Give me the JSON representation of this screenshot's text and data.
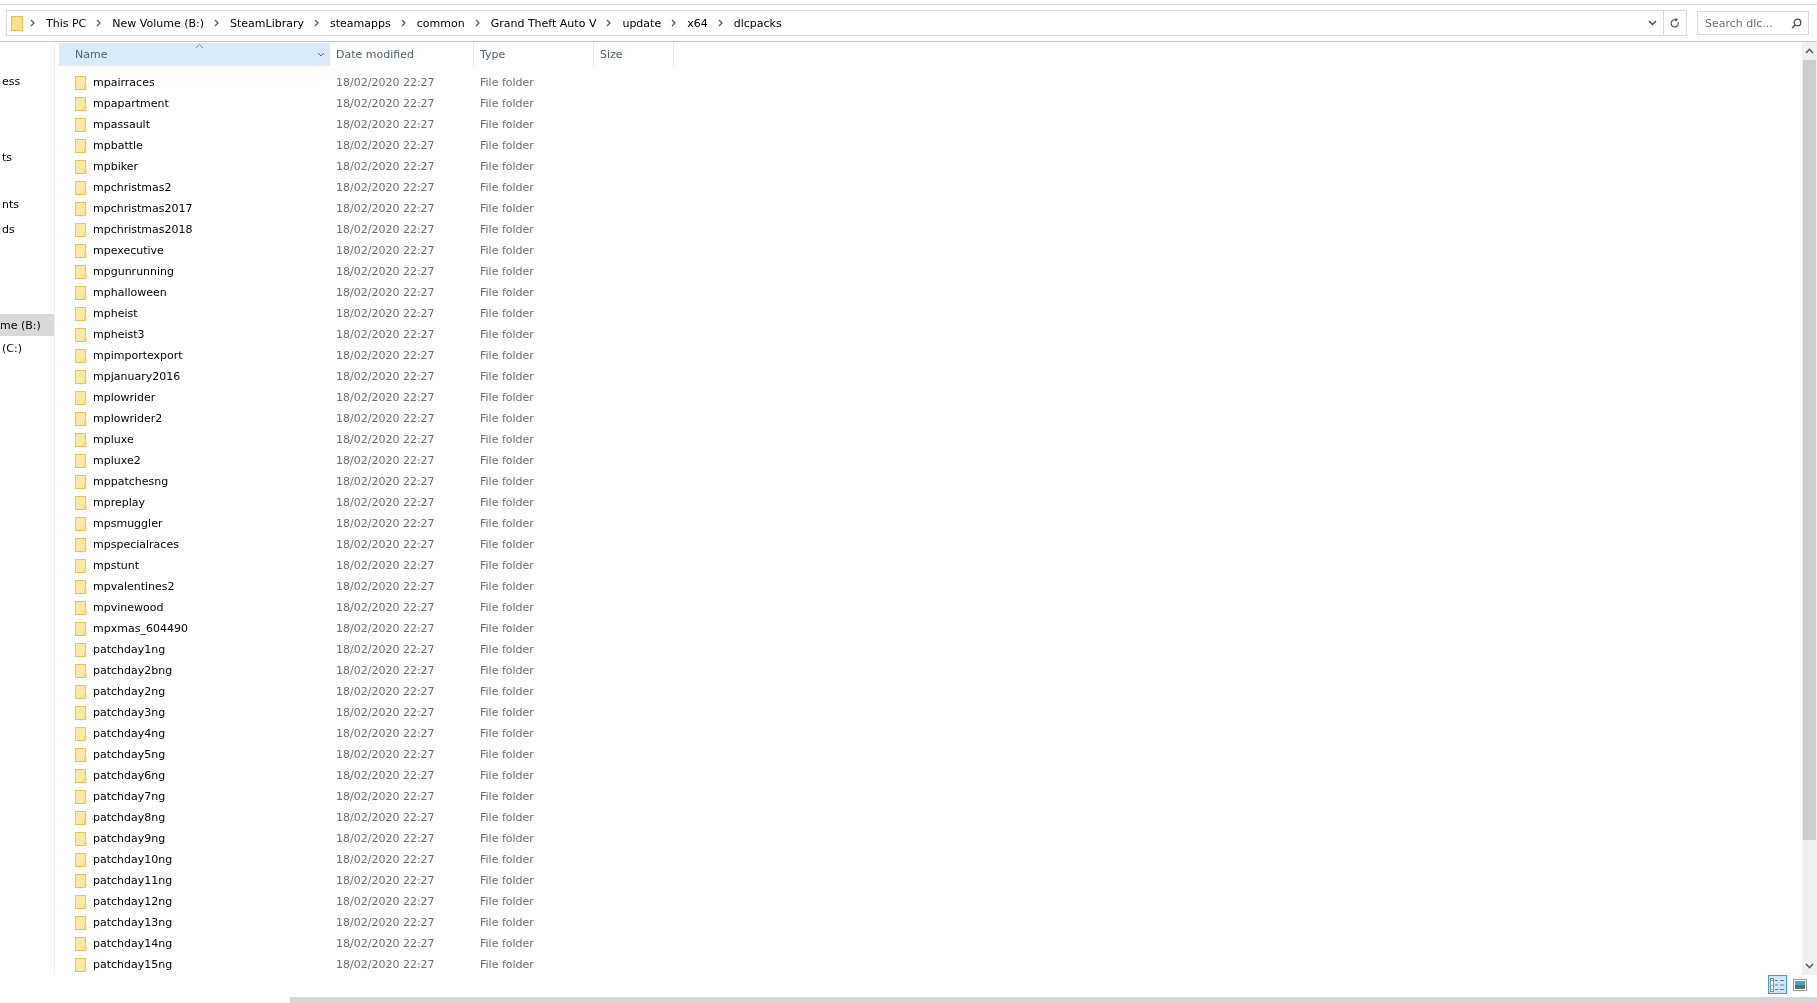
{
  "address_bar": {
    "path": [
      {
        "label": "This PC"
      },
      {
        "label": "New Volume (B:)"
      },
      {
        "label": "SteamLibrary"
      },
      {
        "label": "steamapps"
      },
      {
        "label": "common"
      },
      {
        "label": "Grand Theft Auto V"
      },
      {
        "label": "update"
      },
      {
        "label": "x64"
      },
      {
        "label": "dlcpacks"
      }
    ]
  },
  "search": {
    "placeholder": "Search dlc..."
  },
  "navigation": {
    "items": [
      {
        "label": "ess",
        "selected": false
      },
      {
        "label": "ts",
        "selected": false
      },
      {
        "label": "nts",
        "selected": false
      },
      {
        "label": "ds",
        "selected": false
      },
      {
        "label": "me (B:)",
        "selected": true
      },
      {
        "label": "(C:)",
        "selected": false
      }
    ]
  },
  "table": {
    "columns": [
      {
        "label": "Name",
        "sorted": true
      },
      {
        "label": "Date modified",
        "sorted": false
      },
      {
        "label": "Type",
        "sorted": false
      },
      {
        "label": "Size",
        "sorted": false
      }
    ],
    "rows": [
      {
        "name": "mpairraces",
        "date": "18/02/2020 22:27",
        "type": "File folder"
      },
      {
        "name": "mpapartment",
        "date": "18/02/2020 22:27",
        "type": "File folder"
      },
      {
        "name": "mpassault",
        "date": "18/02/2020 22:27",
        "type": "File folder"
      },
      {
        "name": "mpbattle",
        "date": "18/02/2020 22:27",
        "type": "File folder"
      },
      {
        "name": "mpbiker",
        "date": "18/02/2020 22:27",
        "type": "File folder"
      },
      {
        "name": "mpchristmas2",
        "date": "18/02/2020 22:27",
        "type": "File folder"
      },
      {
        "name": "mpchristmas2017",
        "date": "18/02/2020 22:27",
        "type": "File folder"
      },
      {
        "name": "mpchristmas2018",
        "date": "18/02/2020 22:27",
        "type": "File folder"
      },
      {
        "name": "mpexecutive",
        "date": "18/02/2020 22:27",
        "type": "File folder"
      },
      {
        "name": "mpgunrunning",
        "date": "18/02/2020 22:27",
        "type": "File folder"
      },
      {
        "name": "mphalloween",
        "date": "18/02/2020 22:27",
        "type": "File folder"
      },
      {
        "name": "mpheist",
        "date": "18/02/2020 22:27",
        "type": "File folder"
      },
      {
        "name": "mpheist3",
        "date": "18/02/2020 22:27",
        "type": "File folder"
      },
      {
        "name": "mpimportexport",
        "date": "18/02/2020 22:27",
        "type": "File folder"
      },
      {
        "name": "mpjanuary2016",
        "date": "18/02/2020 22:27",
        "type": "File folder"
      },
      {
        "name": "mplowrider",
        "date": "18/02/2020 22:27",
        "type": "File folder"
      },
      {
        "name": "mplowrider2",
        "date": "18/02/2020 22:27",
        "type": "File folder"
      },
      {
        "name": "mpluxe",
        "date": "18/02/2020 22:27",
        "type": "File folder"
      },
      {
        "name": "mpluxe2",
        "date": "18/02/2020 22:27",
        "type": "File folder"
      },
      {
        "name": "mppatchesng",
        "date": "18/02/2020 22:27",
        "type": "File folder"
      },
      {
        "name": "mpreplay",
        "date": "18/02/2020 22:27",
        "type": "File folder"
      },
      {
        "name": "mpsmuggler",
        "date": "18/02/2020 22:27",
        "type": "File folder"
      },
      {
        "name": "mpspecialraces",
        "date": "18/02/2020 22:27",
        "type": "File folder"
      },
      {
        "name": "mpstunt",
        "date": "18/02/2020 22:27",
        "type": "File folder"
      },
      {
        "name": "mpvalentines2",
        "date": "18/02/2020 22:27",
        "type": "File folder"
      },
      {
        "name": "mpvinewood",
        "date": "18/02/2020 22:27",
        "type": "File folder"
      },
      {
        "name": "mpxmas_604490",
        "date": "18/02/2020 22:27",
        "type": "File folder"
      },
      {
        "name": "patchday1ng",
        "date": "18/02/2020 22:27",
        "type": "File folder"
      },
      {
        "name": "patchday2bng",
        "date": "18/02/2020 22:27",
        "type": "File folder"
      },
      {
        "name": "patchday2ng",
        "date": "18/02/2020 22:27",
        "type": "File folder"
      },
      {
        "name": "patchday3ng",
        "date": "18/02/2020 22:27",
        "type": "File folder"
      },
      {
        "name": "patchday4ng",
        "date": "18/02/2020 22:27",
        "type": "File folder"
      },
      {
        "name": "patchday5ng",
        "date": "18/02/2020 22:27",
        "type": "File folder"
      },
      {
        "name": "patchday6ng",
        "date": "18/02/2020 22:27",
        "type": "File folder"
      },
      {
        "name": "patchday7ng",
        "date": "18/02/2020 22:27",
        "type": "File folder"
      },
      {
        "name": "patchday8ng",
        "date": "18/02/2020 22:27",
        "type": "File folder"
      },
      {
        "name": "patchday9ng",
        "date": "18/02/2020 22:27",
        "type": "File folder"
      },
      {
        "name": "patchday10ng",
        "date": "18/02/2020 22:27",
        "type": "File folder"
      },
      {
        "name": "patchday11ng",
        "date": "18/02/2020 22:27",
        "type": "File folder"
      },
      {
        "name": "patchday12ng",
        "date": "18/02/2020 22:27",
        "type": "File folder"
      },
      {
        "name": "patchday13ng",
        "date": "18/02/2020 22:27",
        "type": "File folder"
      },
      {
        "name": "patchday14ng",
        "date": "18/02/2020 22:27",
        "type": "File folder"
      },
      {
        "name": "patchday15ng",
        "date": "18/02/2020 22:27",
        "type": "File folder"
      }
    ]
  },
  "view_buttons": [
    {
      "kind": "details",
      "selected": true
    },
    {
      "kind": "large-icons",
      "selected": false
    }
  ]
}
